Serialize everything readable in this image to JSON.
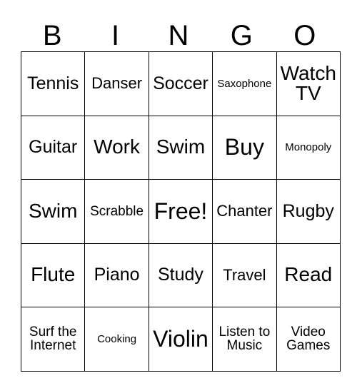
{
  "card": {
    "headers": [
      "B",
      "I",
      "N",
      "G",
      "O"
    ],
    "rows": [
      [
        {
          "text": "Tennis",
          "size": "lg"
        },
        {
          "text": "Danser",
          "size": "md"
        },
        {
          "text": "Soccer",
          "size": "lg"
        },
        {
          "text": "Saxophone",
          "size": "xs"
        },
        {
          "text": "Watch TV",
          "size": "xl"
        }
      ],
      [
        {
          "text": "Guitar",
          "size": "lg"
        },
        {
          "text": "Work",
          "size": "xl"
        },
        {
          "text": "Swim",
          "size": "xl"
        },
        {
          "text": "Buy",
          "size": "xxl"
        },
        {
          "text": "Monopoly",
          "size": "xs"
        }
      ],
      [
        {
          "text": "Swim",
          "size": "xl"
        },
        {
          "text": "Scrabble",
          "size": "sm"
        },
        {
          "text": "Free!",
          "size": "xxl"
        },
        {
          "text": "Chanter",
          "size": "md"
        },
        {
          "text": "Rugby",
          "size": "lg"
        }
      ],
      [
        {
          "text": "Flute",
          "size": "xl"
        },
        {
          "text": "Piano",
          "size": "lg"
        },
        {
          "text": "Study",
          "size": "lg"
        },
        {
          "text": "Travel",
          "size": "md"
        },
        {
          "text": "Read",
          "size": "xl"
        }
      ],
      [
        {
          "text": "Surf the Internet",
          "size": "sm"
        },
        {
          "text": "Cooking",
          "size": "xs"
        },
        {
          "text": "Violin",
          "size": "xxl"
        },
        {
          "text": "Listen to Music",
          "size": "sm"
        },
        {
          "text": "Video Games",
          "size": "sm"
        }
      ]
    ],
    "free_space": {
      "row": 2,
      "col": 2,
      "label": "Free!"
    },
    "colors": {
      "background": "#ffffff",
      "text": "#000000",
      "border": "#000000"
    }
  }
}
